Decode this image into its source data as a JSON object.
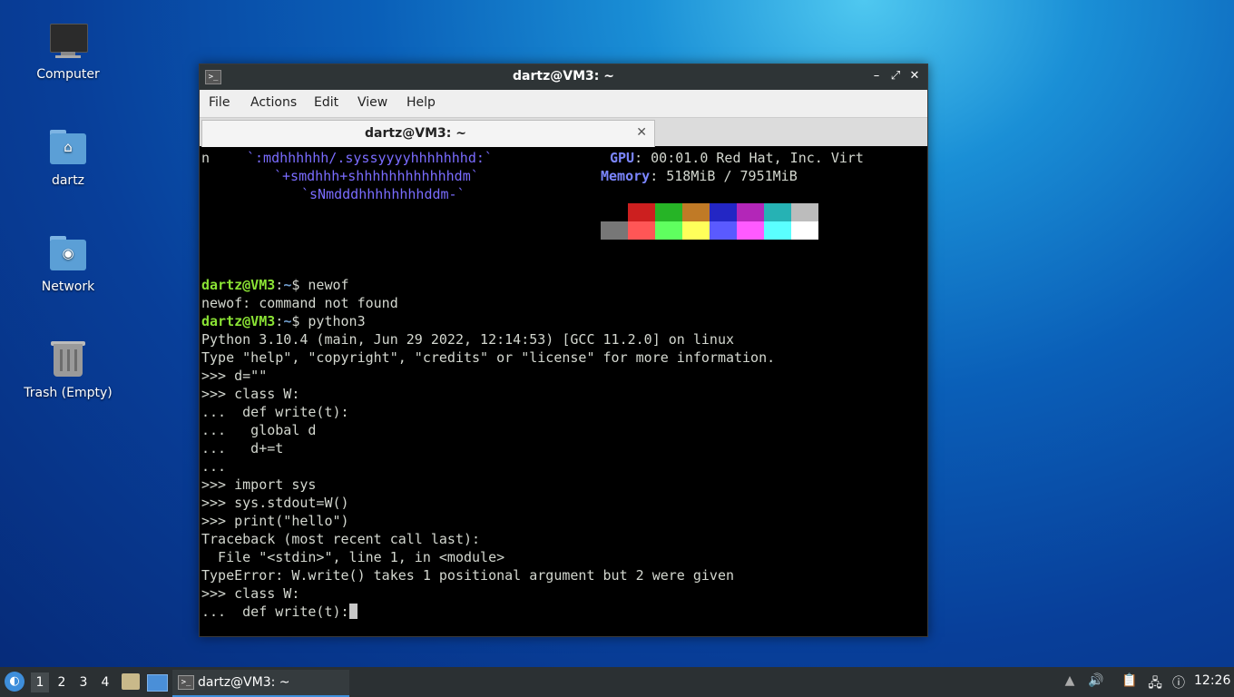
{
  "desktop": {
    "icons": [
      {
        "label": "Computer"
      },
      {
        "label": "dartz"
      },
      {
        "label": "Network"
      },
      {
        "label": "Trash (Empty)"
      }
    ]
  },
  "window": {
    "title": "dartz@VM3: ~",
    "menu": [
      "File",
      "Actions",
      "Edit",
      "View",
      "Help"
    ],
    "tab_label": "dartz@VM3: ~"
  },
  "terminal": {
    "neofetch": {
      "art1_left": "n",
      "art1": "`:mdhhhhhh/.syssyyyyhhhhhhhd:`",
      "art2": "`+smdhhh+shhhhhhhhhhhhdm`",
      "art3": "`sNmdddhhhhhhhhddm-`",
      "gpu_key": "GPU",
      "gpu_val": ": 00:01.0 Red Hat, Inc. Virt",
      "mem_key": "Memory",
      "mem_val": ": 518MiB / 7951MiB",
      "palette_top": [
        "#000000",
        "#cc1f1f",
        "#26b426",
        "#c07a26",
        "#2326c4",
        "#b326b8",
        "#26b2b4",
        "#bcbcbc"
      ],
      "palette_bottom": [
        "#777777",
        "#ff5656",
        "#5fff5f",
        "#ffff5a",
        "#5a5aff",
        "#ff5aff",
        "#5affff",
        "#ffffff"
      ]
    },
    "prompt_user": "dartz@VM3",
    "prompt_path": "~",
    "prompt_sym": "$ ",
    "cmd1": "newof",
    "out1": "newof: command not found",
    "cmd2": "python3",
    "lines": [
      "Python 3.10.4 (main, Jun 29 2022, 12:14:53) [GCC 11.2.0] on linux",
      "Type \"help\", \"copyright\", \"credits\" or \"license\" for more information.",
      ">>> d=\"\"",
      ">>> class W:",
      "...  def write(t):",
      "...   global d",
      "...   d+=t",
      "...",
      ">>> import sys",
      ">>> sys.stdout=W()",
      ">>> print(\"hello\")",
      "Traceback (most recent call last):",
      "  File \"<stdin>\", line 1, in <module>",
      "TypeError: W.write() takes 1 positional argument but 2 were given",
      ">>> class W:"
    ],
    "last_line": "...  def write(t):"
  },
  "taskbar": {
    "workspaces": [
      "1",
      "2",
      "3",
      "4"
    ],
    "task_label": "dartz@VM3: ~",
    "clock": "12:26"
  }
}
